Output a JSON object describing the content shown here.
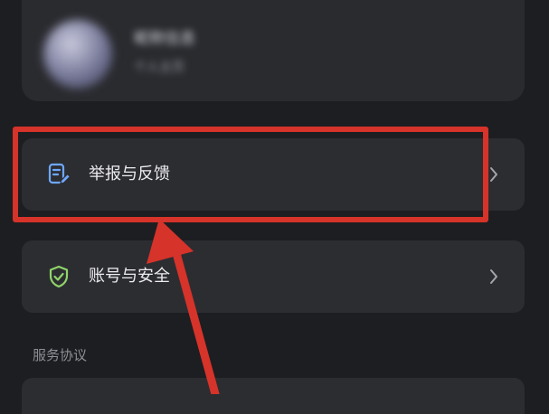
{
  "profile": {
    "name": "昵称信息",
    "subtitle": "个人主页"
  },
  "menu": {
    "feedback": {
      "label": "举报与反馈",
      "icon": "feedback-icon"
    },
    "account_security": {
      "label": "账号与安全",
      "icon": "shield-check-icon"
    }
  },
  "sections": {
    "service_agreement": "服务协议"
  },
  "annotation": {
    "highlight_color": "#d6332a",
    "arrow_color": "#d6332a"
  },
  "colors": {
    "background": "#1d1e21",
    "card": "#2c2d31",
    "feedback_icon": "#6ea8ff",
    "shield_icon": "#8fd46a"
  }
}
